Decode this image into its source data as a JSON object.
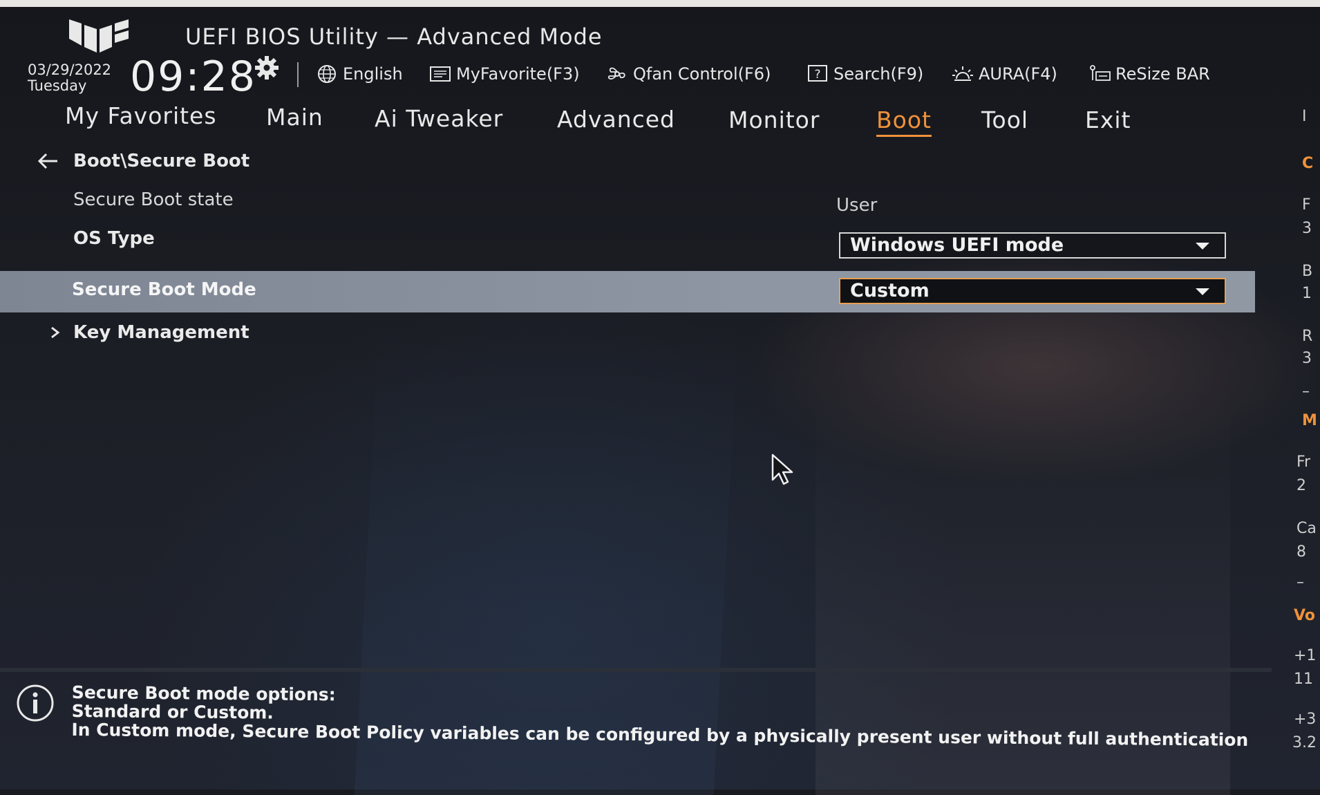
{
  "header": {
    "title": "UEFI BIOS Utility — Advanced Mode",
    "date": "03/29/2022",
    "weekday": "Tuesday",
    "time": "09:28",
    "hotkeys": [
      {
        "label": "English",
        "icon": "globe-icon"
      },
      {
        "label": "MyFavorite(F3)",
        "icon": "favorite-list-icon"
      },
      {
        "label": "Qfan Control(F6)",
        "icon": "fan-icon"
      },
      {
        "label": "Search(F9)",
        "icon": "search-question-icon"
      },
      {
        "label": "AURA(F4)",
        "icon": "aura-light-icon"
      },
      {
        "label": "ReSize BAR",
        "icon": "resize-bar-icon"
      }
    ]
  },
  "tabs": [
    {
      "label": "My Favorites"
    },
    {
      "label": "Main"
    },
    {
      "label": "Ai Tweaker"
    },
    {
      "label": "Advanced"
    },
    {
      "label": "Monitor"
    },
    {
      "label": "Boot",
      "active": true
    },
    {
      "label": "Tool"
    },
    {
      "label": "Exit"
    }
  ],
  "breadcrumb": "Boot\\Secure Boot",
  "settings": {
    "secure_boot_state": {
      "label": "Secure Boot state",
      "value": "User"
    },
    "os_type": {
      "label": "OS Type",
      "value": "Windows UEFI mode"
    },
    "secure_boot_mode": {
      "label": "Secure Boot Mode",
      "value": "Custom"
    },
    "key_management": {
      "label": "Key Management"
    }
  },
  "help": {
    "line1": "Secure Boot mode options:",
    "line2": "Standard or Custom.",
    "line3": "In Custom mode, Secure Boot Policy variables can be configured by a physically present user without full authentication"
  },
  "right_panel_partial": [
    "I",
    "C",
    "F",
    "3",
    "B",
    "1",
    "R",
    "3",
    "–",
    "M",
    "Fr",
    "2",
    "Ca",
    "8",
    "–",
    "Vo",
    "+1",
    "11",
    "+3",
    "3.2"
  ],
  "colors": {
    "accent": "#f0923a",
    "highlight_row": "#8a92a0",
    "background": "#1c1e24"
  }
}
